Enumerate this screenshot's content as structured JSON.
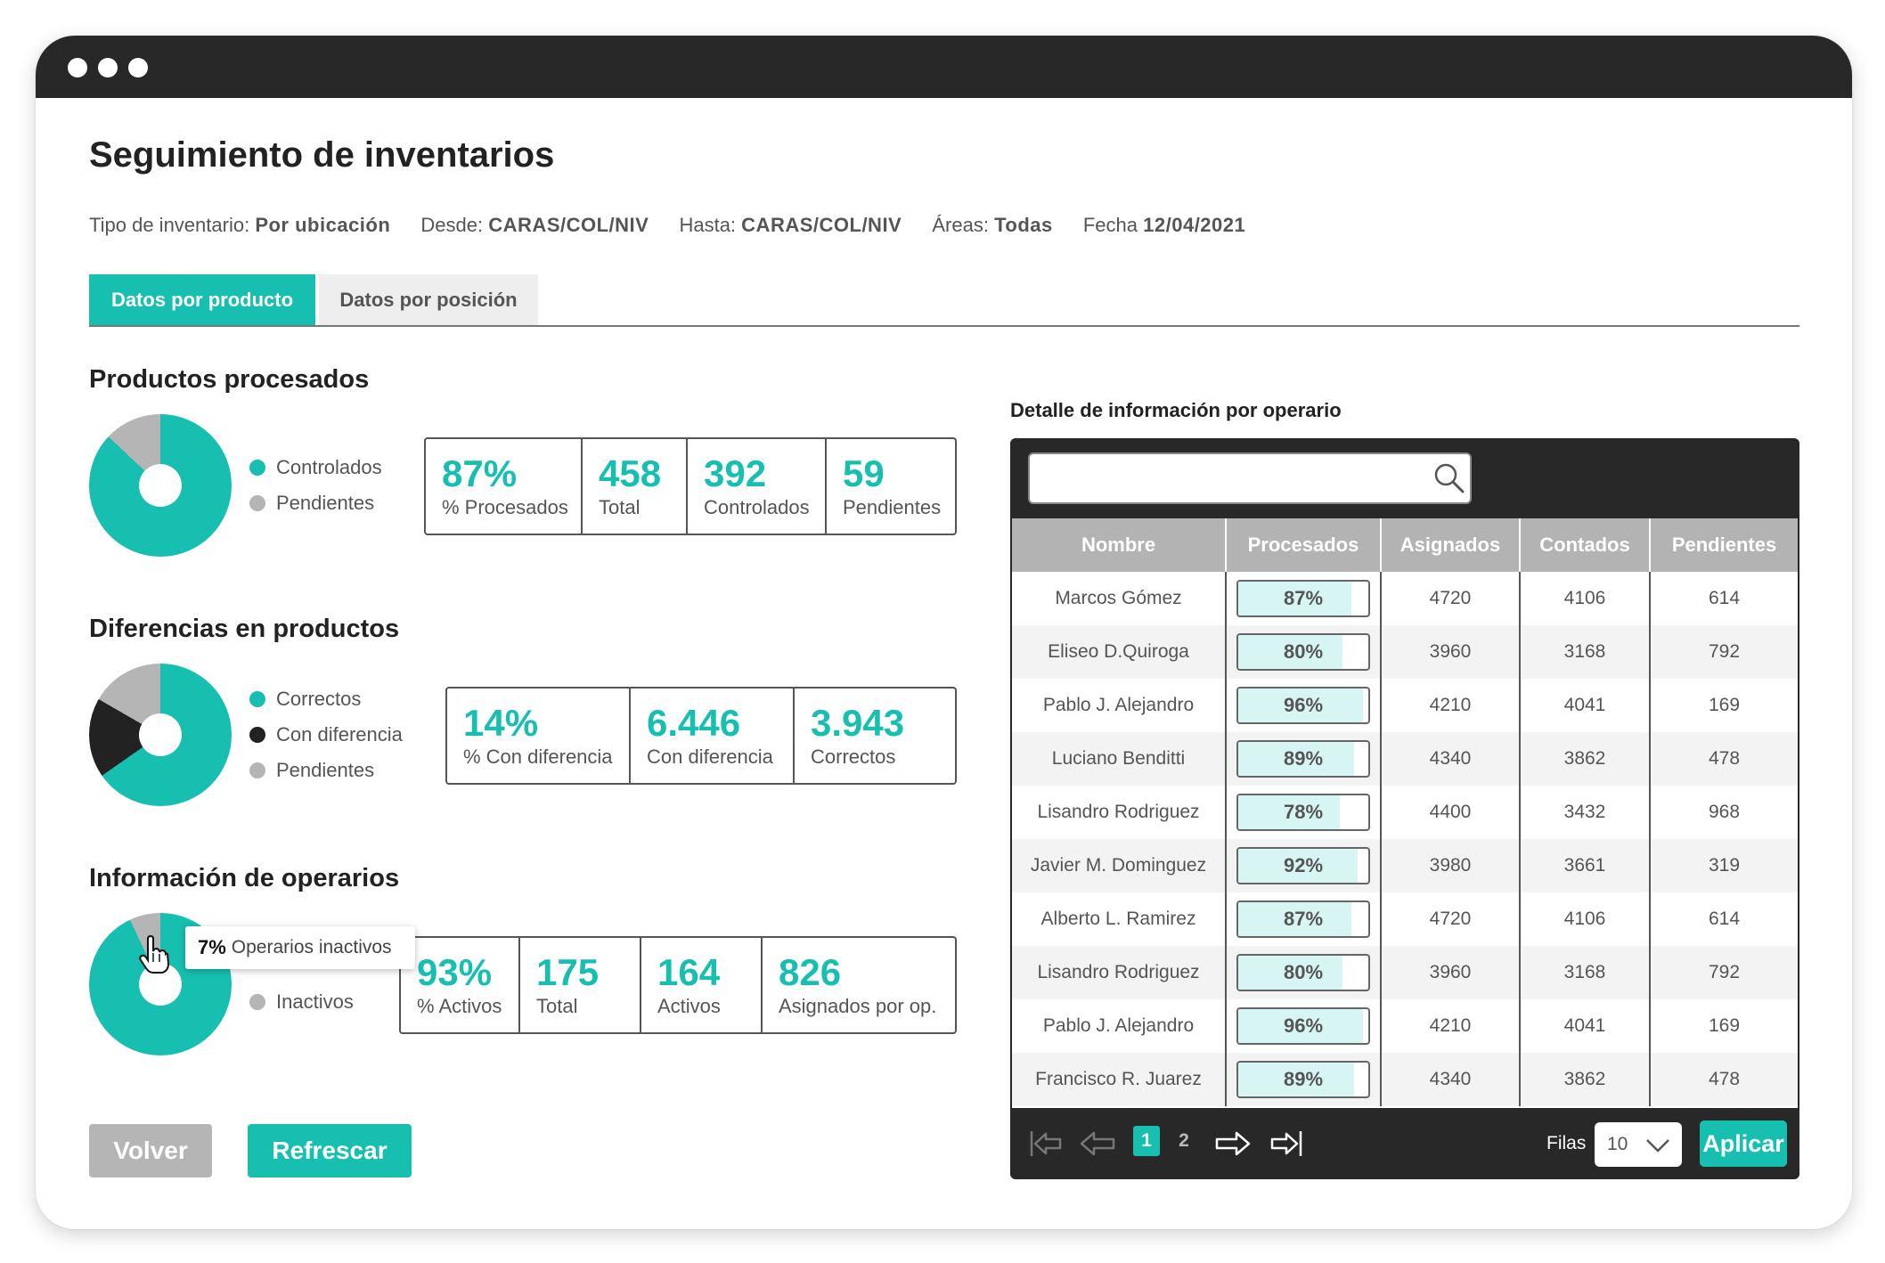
{
  "title": "Seguimiento de inventarios",
  "filters": [
    {
      "label": "Tipo de inventario:",
      "value": "Por ubicación"
    },
    {
      "label": "Desde:",
      "value": "CARAS/COL/NIV"
    },
    {
      "label": "Hasta:",
      "value": "CARAS/COL/NIV"
    },
    {
      "label": "Áreas:",
      "value": "Todas"
    },
    {
      "label": "Fecha",
      "value": "12/04/2021"
    }
  ],
  "tabs": [
    {
      "label": "Datos por producto",
      "active": true
    },
    {
      "label": "Datos por posición",
      "active": false
    }
  ],
  "colors": {
    "accent": "#17bfb1",
    "gray": "#b5b5b5",
    "dark": "#282828"
  },
  "sections": {
    "processed": {
      "title": "Productos procesados",
      "legend": [
        {
          "label": "Controlados",
          "color": "#17bfb1"
        },
        {
          "label": "Pendientes",
          "color": "#b5b5b5"
        }
      ],
      "pie_fraction_controlados": 0.87,
      "stats": [
        {
          "value": "87%",
          "label": "% Procesados"
        },
        {
          "value": "458",
          "label": "Total"
        },
        {
          "value": "392",
          "label": "Controlados"
        },
        {
          "value": "59",
          "label": "Pendientes"
        }
      ]
    },
    "differences": {
      "title": "Diferencias en productos",
      "legend": [
        {
          "label": "Correctos",
          "color": "#17bfb1"
        },
        {
          "label": "Con diferencia",
          "color": "#222222"
        },
        {
          "label": "Pendientes",
          "color": "#b5b5b5"
        }
      ],
      "stats": [
        {
          "value": "14%",
          "label": "% Con diferencia"
        },
        {
          "value": "6.446",
          "label": "Con diferencia"
        },
        {
          "value": "3.943",
          "label": "Correctos"
        }
      ]
    },
    "operators": {
      "title": "Información de operarios",
      "legend": [
        {
          "label": "Inactivos",
          "color": "#b5b5b5"
        }
      ],
      "tooltip": {
        "value": "7%",
        "label": "Operarios inactivos"
      },
      "stats": [
        {
          "value": "93%",
          "label": "% Activos"
        },
        {
          "value": "175",
          "label": "Total"
        },
        {
          "value": "164",
          "label": "Activos"
        },
        {
          "value": "826",
          "label": "Asignados por op."
        }
      ]
    }
  },
  "buttons": {
    "back": "Volver",
    "refresh": "Refrescar"
  },
  "detail": {
    "title": "Detalle de información por operario",
    "search_placeholder": "",
    "columns": [
      "Nombre",
      "Procesados",
      "Asignados",
      "Contados",
      "Pendientes"
    ],
    "rows": [
      {
        "name": "Marcos Gómez",
        "processed": "87%",
        "assigned": "4720",
        "counted": "4106",
        "pending": "614"
      },
      {
        "name": "Eliseo D.Quiroga",
        "processed": "80%",
        "assigned": "3960",
        "counted": "3168",
        "pending": "792"
      },
      {
        "name": "Pablo J. Alejandro",
        "processed": "96%",
        "assigned": "4210",
        "counted": "4041",
        "pending": "169"
      },
      {
        "name": "Luciano Benditti",
        "processed": "89%",
        "assigned": "4340",
        "counted": "3862",
        "pending": "478"
      },
      {
        "name": "Lisandro Rodriguez",
        "processed": "78%",
        "assigned": "4400",
        "counted": "3432",
        "pending": "968"
      },
      {
        "name": "Javier M. Dominguez",
        "processed": "92%",
        "assigned": "3980",
        "counted": "3661",
        "pending": "319"
      },
      {
        "name": "Alberto L. Ramirez",
        "processed": "87%",
        "assigned": "4720",
        "counted": "4106",
        "pending": "614"
      },
      {
        "name": "Lisandro Rodriguez",
        "processed": "80%",
        "assigned": "3960",
        "counted": "3168",
        "pending": "792"
      },
      {
        "name": "Pablo J. Alejandro",
        "processed": "96%",
        "assigned": "4210",
        "counted": "4041",
        "pending": "169"
      },
      {
        "name": "Francisco R. Juarez",
        "processed": "89%",
        "assigned": "4340",
        "counted": "3862",
        "pending": "478"
      }
    ],
    "pagination": {
      "pages": [
        "1",
        "2"
      ],
      "current": "1",
      "rows_label": "Filas",
      "rows_value": "10",
      "apply_label": "Aplicar"
    }
  }
}
